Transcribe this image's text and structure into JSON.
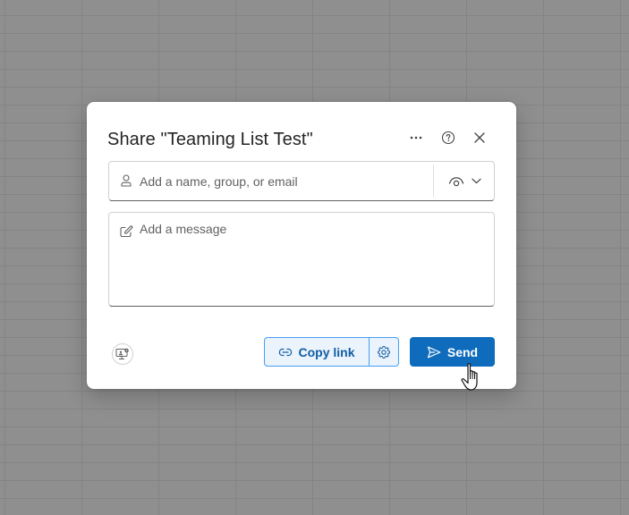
{
  "dialog": {
    "title": "Share \"Teaming List Test\"",
    "more_options_icon": "ellipsis-icon",
    "help_icon": "question-circle-icon",
    "close_icon": "close-icon"
  },
  "people_picker": {
    "placeholder": "Add a name, group, or email",
    "value": "",
    "icon": "person-icon",
    "permission_icon": "eye-icon",
    "dropdown_icon": "chevron-down-icon"
  },
  "message": {
    "placeholder": "Add a message",
    "value": "",
    "icon": "compose-icon"
  },
  "footer": {
    "share_settings_icon": "people-settings-icon",
    "copy_link_label": "Copy link",
    "copy_link_icon": "link-icon",
    "link_settings_icon": "gear-icon",
    "send_label": "Send",
    "send_icon": "send-icon"
  },
  "colors": {
    "primary": "#0f6cbd",
    "primary_light": "#ebf3fc",
    "primary_border": "#479ef5",
    "link_text": "#115ea3"
  }
}
